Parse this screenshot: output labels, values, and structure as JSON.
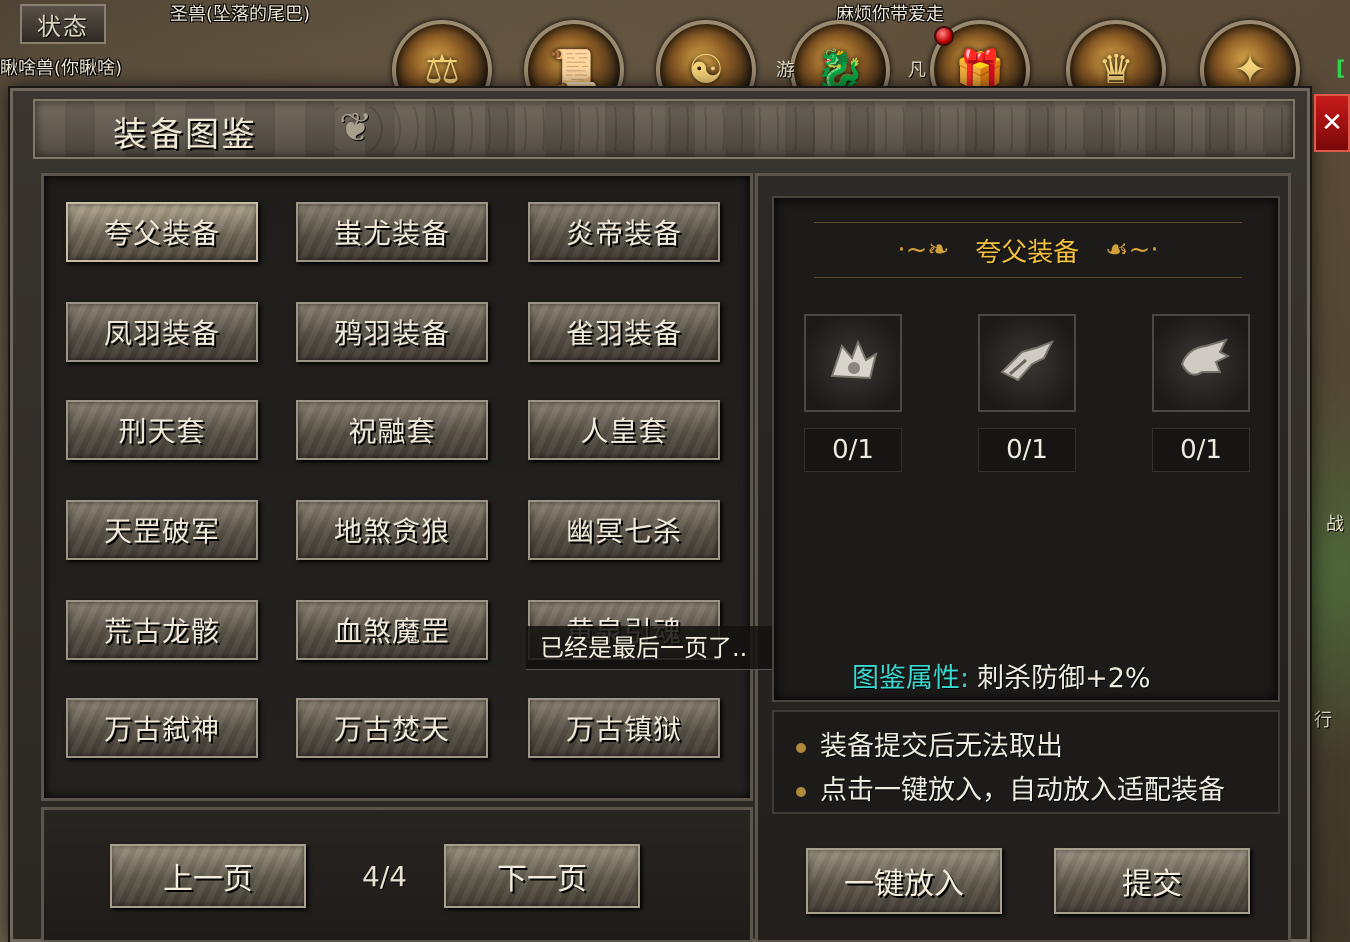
{
  "hud": {
    "status_label": "状态",
    "pet_name_1": "圣兽(坠落的尾巴)",
    "pet_name_2": "瞅啥兽(你瞅啥)",
    "companion_name": "麻烦你带爱走",
    "edge_char_1": "凡",
    "edge_char_2": "游",
    "edge_char_3": "战",
    "edge_char_4": "行",
    "icons": [
      "balance-icon",
      "scroll-icon",
      "warrior-portrait-icon",
      "golden-dragon-icon",
      "gift-box-icon",
      "crown-icon",
      "treasure-icon"
    ]
  },
  "panel": {
    "title": "装备图鉴",
    "close_label": "✕"
  },
  "sets": [
    {
      "label": "夸父装备"
    },
    {
      "label": "蚩尤装备"
    },
    {
      "label": "炎帝装备"
    },
    {
      "label": "凤羽装备"
    },
    {
      "label": "鸦羽装备"
    },
    {
      "label": "雀羽装备"
    },
    {
      "label": "刑天套"
    },
    {
      "label": "祝融套"
    },
    {
      "label": "人皇套"
    },
    {
      "label": "天罡破军"
    },
    {
      "label": "地煞贪狼"
    },
    {
      "label": "幽冥七杀"
    },
    {
      "label": "荒古龙骸"
    },
    {
      "label": "血煞魔罡"
    },
    {
      "label": "黄泉引魂"
    },
    {
      "label": "万古弑神"
    },
    {
      "label": "万古焚天"
    },
    {
      "label": "万古镇狱"
    }
  ],
  "tooltip": "已经是最后一页了..",
  "pager": {
    "prev_label": "上一页",
    "page_indicator": "4/4",
    "next_label": "下一页"
  },
  "detail": {
    "title": "夸父装备",
    "slots": [
      {
        "icon": "winged-helmet-icon",
        "count": "0/1"
      },
      {
        "icon": "winged-bracer-icon",
        "count": "0/1"
      },
      {
        "icon": "claw-gauntlet-icon",
        "count": "0/1"
      }
    ],
    "attr_label": "图鉴属性:",
    "attr_value": "刺杀防御+2%"
  },
  "tips": [
    "装备提交后无法取出",
    "点击一键放入，自动放入适配装备"
  ],
  "actions": {
    "auto_fill_label": "一键放入",
    "submit_label": "提交"
  },
  "colors": {
    "accent_gold": "#f2c03a",
    "attr_cyan": "#3ad8d0",
    "close_red": "#c81a1a"
  }
}
